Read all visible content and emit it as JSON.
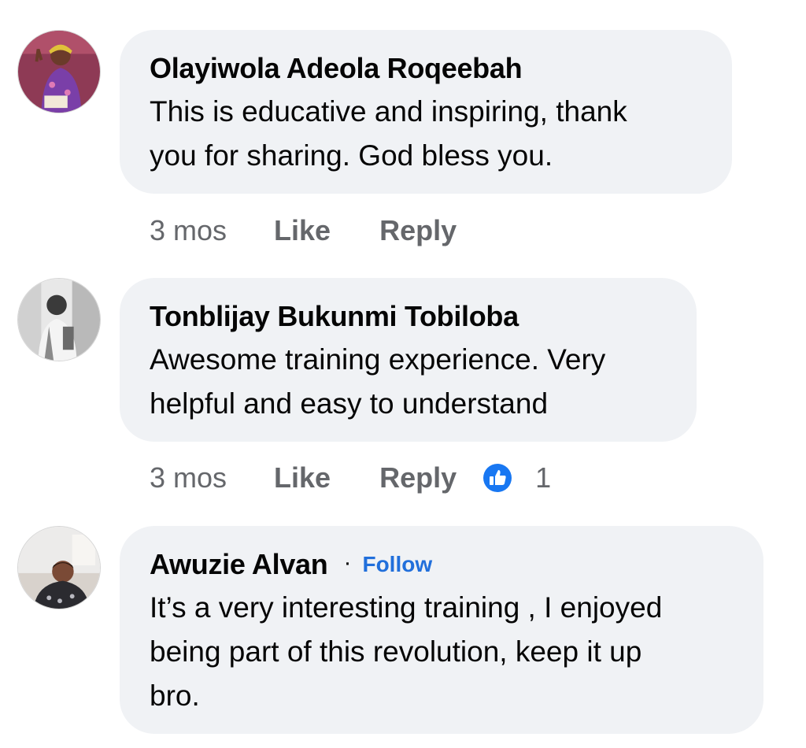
{
  "comments": [
    {
      "author": "Olayiwola Adeola Roqeebah",
      "text_lines": [
        "This is educative and inspiring, thank",
        "you for sharing. God bless you."
      ],
      "time": "3 mos",
      "like_label": "Like",
      "reply_label": "Reply"
    },
    {
      "author": "Tonblijay Bukunmi Tobiloba",
      "text_lines": [
        "Awesome training experience. Very",
        "helpful and easy to understand"
      ],
      "time": "3 mos",
      "like_label": "Like",
      "reply_label": "Reply",
      "reaction_icon": "like-reaction-icon",
      "reaction_count": "1"
    },
    {
      "author": "Awuzie Alvan",
      "separator": "·",
      "follow_label": "Follow",
      "text_lines": [
        "It’s a very interesting training , I enjoyed",
        "being part of this revolution, keep it up",
        "bro."
      ]
    }
  ],
  "colors": {
    "bubble": "#f0f2f5",
    "link_blue": "#216fdb",
    "secondary_text": "#65676b",
    "like_blue": "#1877f2"
  }
}
